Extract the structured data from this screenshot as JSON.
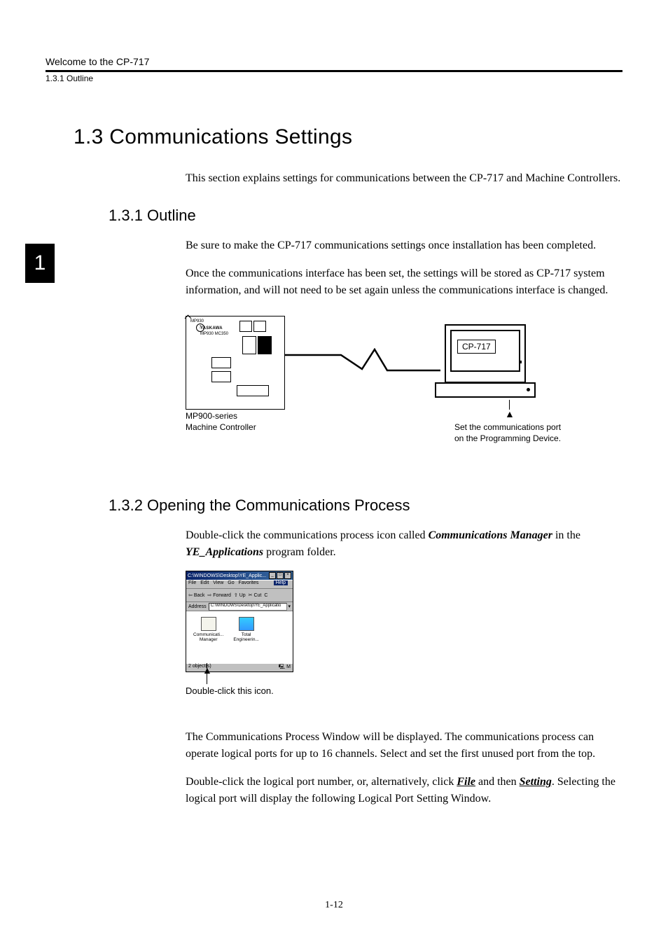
{
  "header": {
    "running_head": "Welcome to the CP-717",
    "sub_running_head": "1.3.1  Outline"
  },
  "side_tab": "1",
  "section": {
    "num_title": "1.3  Communications Settings",
    "intro": "This section explains settings for communications between the CP-717 and Machine Controllers."
  },
  "sub1": {
    "heading": "1.3.1  Outline",
    "p1": "Be sure to make the CP-717 communications settings once installation has been completed.",
    "p2": "Once the communications interface has been set, the settings will be stored as CP-717 system information, and will not need to be set again unless the communications interface is changed."
  },
  "diagram": {
    "controller_top_label": "MP930",
    "controller_brand": "YASKAWA",
    "controller_model": "MP930  MC350",
    "left_caption_line1": "MP900-series",
    "left_caption_line2": "Machine Controller",
    "pc_label": "CP-717",
    "right_caption_line1": "Set the communications port",
    "right_caption_line2": "on the Programming Device."
  },
  "sub2": {
    "heading": "1.3.2  Opening the Communications Process",
    "p1_prefix": "Double-click the communications process icon called ",
    "p1_bold1": "Communications Manager",
    "p1_mid": " in the ",
    "p1_bold2": "YE_Applications",
    "p1_suffix": " program folder.",
    "shot_caption": "Double-click this icon.",
    "p2": "The Communications Process Window will be displayed. The communications process can operate logical ports for up to 16 channels. Select and set the first unused port from the top.",
    "p3_prefix": "Double-click the logical port number, or, alternatively, click ",
    "p3_file": "File",
    "p3_mid": " and then ",
    "p3_setting": "Setting",
    "p3_suffix": ". Selecting the logical port will display the following Logical Port Setting Window."
  },
  "win98": {
    "title": "C:\\WINDOWS\\Desktop\\YE_Applic...",
    "menu": {
      "file": "File",
      "edit": "Edit",
      "view": "View",
      "go": "Go",
      "fav": "Favorites",
      "help": "Help"
    },
    "toolbar": {
      "back": "Back",
      "forward": "Forward",
      "up": "Up",
      "cut": "Cut",
      "copy": "C"
    },
    "address_label": "Address",
    "address_value": "C:\\WINDOWS\\Desktop\\YE_Applicatio",
    "icon1_line1": "Communicati...",
    "icon1_line2": "Manager",
    "icon2_line1": "Total",
    "icon2_line2": "Engineerin...",
    "status_left": "2 object(s)",
    "status_right": "M"
  },
  "page_number": "1-12"
}
